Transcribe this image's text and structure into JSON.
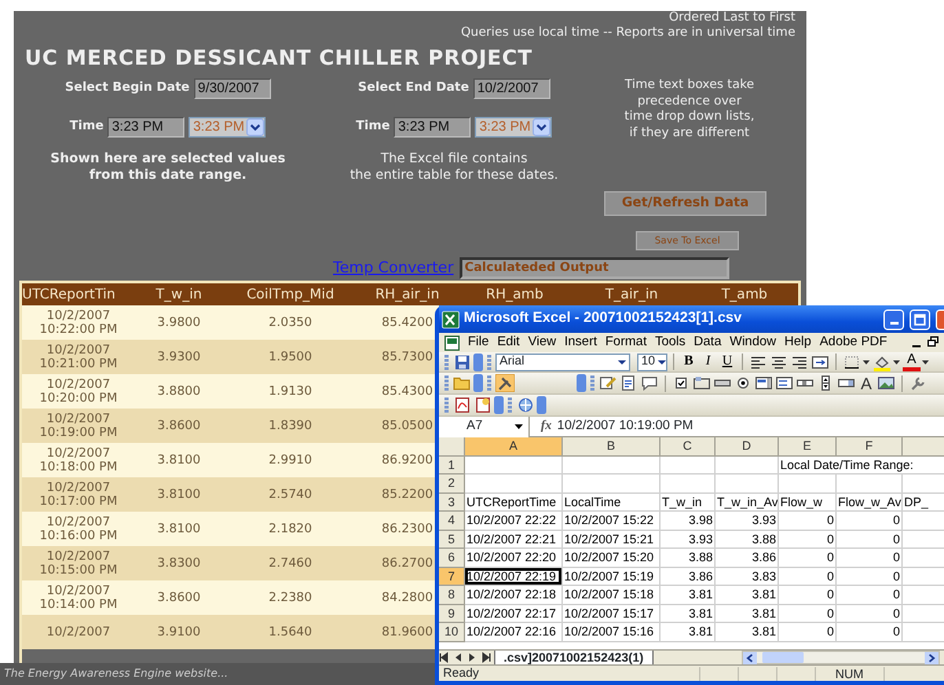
{
  "page": {
    "sort_note": "Ordered Last to First",
    "time_note": "Queries use local time -- Reports are in universal time",
    "title": "UC MERCED DESSICANT CHILLER PROJECT",
    "ranges": [
      {
        "label": "Select Begin Date",
        "date": "9/30/2007",
        "time_label": "Time",
        "time": "3:23 PM",
        "time_choice": "3:23 PM"
      },
      {
        "label": "Select End Date",
        "date": "10/2/2007",
        "time_label": "Time",
        "time": "3:23 PM",
        "time_choice": "3:23 PM"
      }
    ],
    "precedence_note": [
      "Time text boxes take",
      "precedence over",
      "time drop down lists,",
      "if they are different"
    ],
    "selection_note": [
      "Shown here are selected values",
      "from this date range."
    ],
    "excel_note": [
      "The Excel file contains",
      "the entire table for these dates."
    ],
    "buttons": [
      {
        "label": "Get/Refresh Data",
        "kind": "large"
      },
      {
        "label": "Save To Excel",
        "kind": "small"
      }
    ],
    "converter": {
      "link": "Temp Converter",
      "output": "Calculateded Output"
    }
  },
  "table": {
    "columns": [
      "UTCReportTin",
      "T_w_in",
      "CoilTmp_Mid",
      "RH_air_in",
      "RH_amb",
      "T_air_in",
      "T_amb"
    ],
    "rows": [
      {
        "time": [
          "10/2/2007",
          "10:22:00 PM"
        ],
        "values": [
          "3.9800",
          "2.0350",
          "85.4200"
        ]
      },
      {
        "time": [
          "10/2/2007",
          "10:21:00 PM"
        ],
        "values": [
          "3.9300",
          "1.9500",
          "85.7300"
        ]
      },
      {
        "time": [
          "10/2/2007",
          "10:20:00 PM"
        ],
        "values": [
          "3.8800",
          "1.9130",
          "85.4300"
        ]
      },
      {
        "time": [
          "10/2/2007",
          "10:19:00 PM"
        ],
        "values": [
          "3.8600",
          "1.8390",
          "85.0500"
        ]
      },
      {
        "time": [
          "10/2/2007",
          "10:18:00 PM"
        ],
        "values": [
          "3.8100",
          "2.9910",
          "86.9200"
        ]
      },
      {
        "time": [
          "10/2/2007",
          "10:17:00 PM"
        ],
        "values": [
          "3.8100",
          "2.5740",
          "85.2200"
        ]
      },
      {
        "time": [
          "10/2/2007",
          "10:16:00 PM"
        ],
        "values": [
          "3.8100",
          "2.1820",
          "86.2300"
        ]
      },
      {
        "time": [
          "10/2/2007",
          "10:15:00 PM"
        ],
        "values": [
          "3.8300",
          "2.7460",
          "86.2700"
        ]
      },
      {
        "time": [
          "10/2/2007",
          "10:14:00 PM"
        ],
        "values": [
          "3.8600",
          "2.2380",
          "84.2800"
        ]
      },
      {
        "time": [
          "10/2/2007"
        ],
        "values": [
          "3.9100",
          "1.5640",
          "81.9600"
        ]
      }
    ]
  },
  "footer": "The Energy Awareness Engine website...",
  "excel": {
    "title": "Microsoft Excel - 20071002152423[1].csv",
    "menu": [
      "File",
      "Edit",
      "View",
      "Insert",
      "Format",
      "Tools",
      "Data",
      "Window",
      "Help",
      "Adobe PDF"
    ],
    "font": "Arial",
    "font_size": "10",
    "format_buttons": [
      "B",
      "I",
      "U"
    ],
    "font_color_label": "A",
    "label_tool": "A",
    "name_box": "A7",
    "fx": "fx",
    "formula": "10/2/2007  10:19:00 PM",
    "columns": [
      {
        "label": "A",
        "selected": true
      },
      {
        "label": "B",
        "selected": false
      },
      {
        "label": "C",
        "selected": false
      },
      {
        "label": "D",
        "selected": false
      },
      {
        "label": "E",
        "selected": false
      },
      {
        "label": "F",
        "selected": false
      }
    ],
    "rows": [
      {
        "number": "1",
        "selected": false,
        "kind": "blank",
        "cells": [
          null,
          null,
          null,
          null,
          "Local Date/Time Range:"
        ]
      },
      {
        "number": "2",
        "selected": false,
        "kind": "blank"
      },
      {
        "number": "3",
        "selected": false,
        "kind": "header",
        "cells": [
          "UTCReportTime",
          "LocalTime",
          "T_w_in",
          "T_w_in_Av",
          "Flow_w",
          "Flow_w_Av",
          "DP_"
        ]
      },
      {
        "number": "4",
        "selected": false,
        "kind": "data",
        "cells": [
          "10/2/2007 22:22",
          "10/2/2007 15:22",
          "3.98",
          "3.93",
          "0",
          "0"
        ]
      },
      {
        "number": "5",
        "selected": false,
        "kind": "data",
        "cells": [
          "10/2/2007 22:21",
          "10/2/2007 15:21",
          "3.93",
          "3.88",
          "0",
          "0"
        ]
      },
      {
        "number": "6",
        "selected": false,
        "kind": "data",
        "cells": [
          "10/2/2007 22:20",
          "10/2/2007 15:20",
          "3.88",
          "3.86",
          "0",
          "0"
        ]
      },
      {
        "number": "7",
        "selected": true,
        "kind": "data",
        "cells": [
          "10/2/2007 22:19",
          "10/2/2007 15:19",
          "3.86",
          "3.83",
          "0",
          "0"
        ]
      },
      {
        "number": "8",
        "selected": false,
        "kind": "data",
        "cells": [
          "10/2/2007 22:18",
          "10/2/2007 15:18",
          "3.81",
          "3.81",
          "0",
          "0"
        ]
      },
      {
        "number": "9",
        "selected": false,
        "kind": "data",
        "cells": [
          "10/2/2007 22:17",
          "10/2/2007 15:17",
          "3.81",
          "3.81",
          "0",
          "0"
        ]
      },
      {
        "number": "10",
        "selected": false,
        "kind": "data",
        "cells": [
          "10/2/2007 22:16",
          "10/2/2007 15:16",
          "3.81",
          "3.81",
          "0",
          "0"
        ]
      }
    ],
    "sheet_tab": ".csv]20071002152423(1)",
    "status": "Ready",
    "indicator": "NUM"
  }
}
